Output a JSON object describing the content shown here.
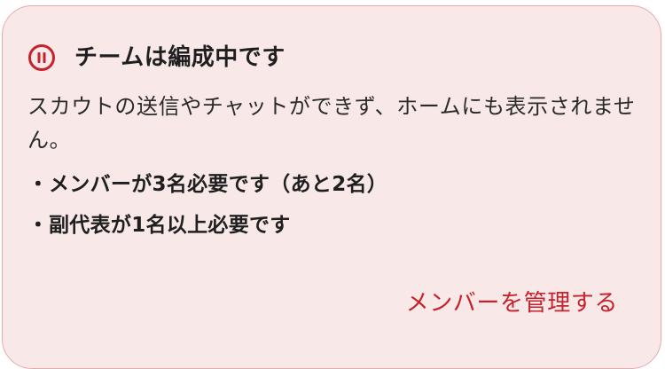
{
  "colors": {
    "card_background": "#f8e8e8",
    "card_border": "#e6aaaa",
    "accent_red": "#c5222b",
    "text_dark": "#1f1f1f"
  },
  "notice": {
    "icon": "pause-circle-icon",
    "title": "チームは編成中です",
    "description": "スカウトの送信やチャットができず、ホームにも表示されません。",
    "requirements": [
      {
        "bullet": "・",
        "text": "メンバーが3名必要です（あと2名）"
      },
      {
        "bullet": "・",
        "text": "副代表が1名以上必要です"
      }
    ],
    "action_label": "メンバーを管理する"
  }
}
